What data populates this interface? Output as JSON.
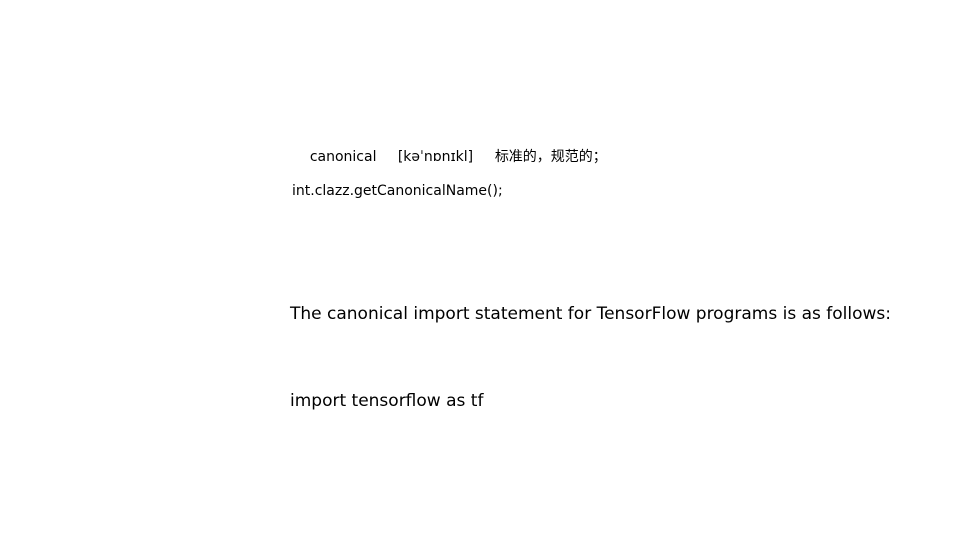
{
  "vocab": {
    "word": "canonical",
    "phonetic": "[kəˈnɒnɪkl]",
    "meaning": "标准的，规范的；"
  },
  "code_line": "int.clazz.getCanonicalName();",
  "paragraph": {
    "line1": "The canonical import statement for TensorFlow programs is as follows:",
    "line2": "import tensorflow as tf"
  }
}
